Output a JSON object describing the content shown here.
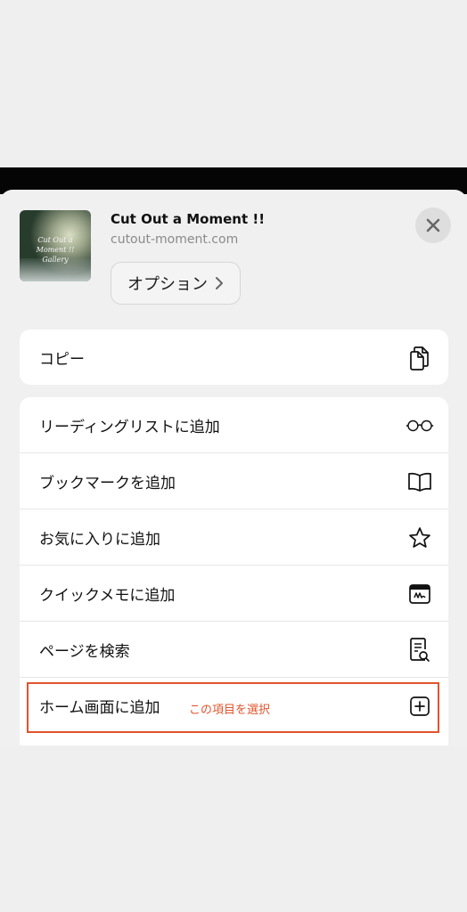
{
  "site": {
    "title": "Cut Out a Moment !!",
    "url": "cutout-moment.com",
    "thumbnail_text": "Cut Out a Moment !! Gallery"
  },
  "header": {
    "options_label": "オプション",
    "close_icon": "close-icon"
  },
  "actions": {
    "copy": {
      "label": "コピー",
      "icon": "document-copy-icon"
    },
    "items": [
      {
        "label": "リーディングリストに追加",
        "icon": "glasses-icon"
      },
      {
        "label": "ブックマークを追加",
        "icon": "book-icon"
      },
      {
        "label": "お気に入りに追加",
        "icon": "star-icon"
      },
      {
        "label": "クイックメモに追加",
        "icon": "quick-note-icon"
      },
      {
        "label": "ページを検索",
        "icon": "page-search-icon"
      },
      {
        "label": "ホーム画面に追加",
        "icon": "plus-square-icon"
      }
    ]
  },
  "annotation": {
    "text": "この項目を選択",
    "color": "#e1542d"
  }
}
